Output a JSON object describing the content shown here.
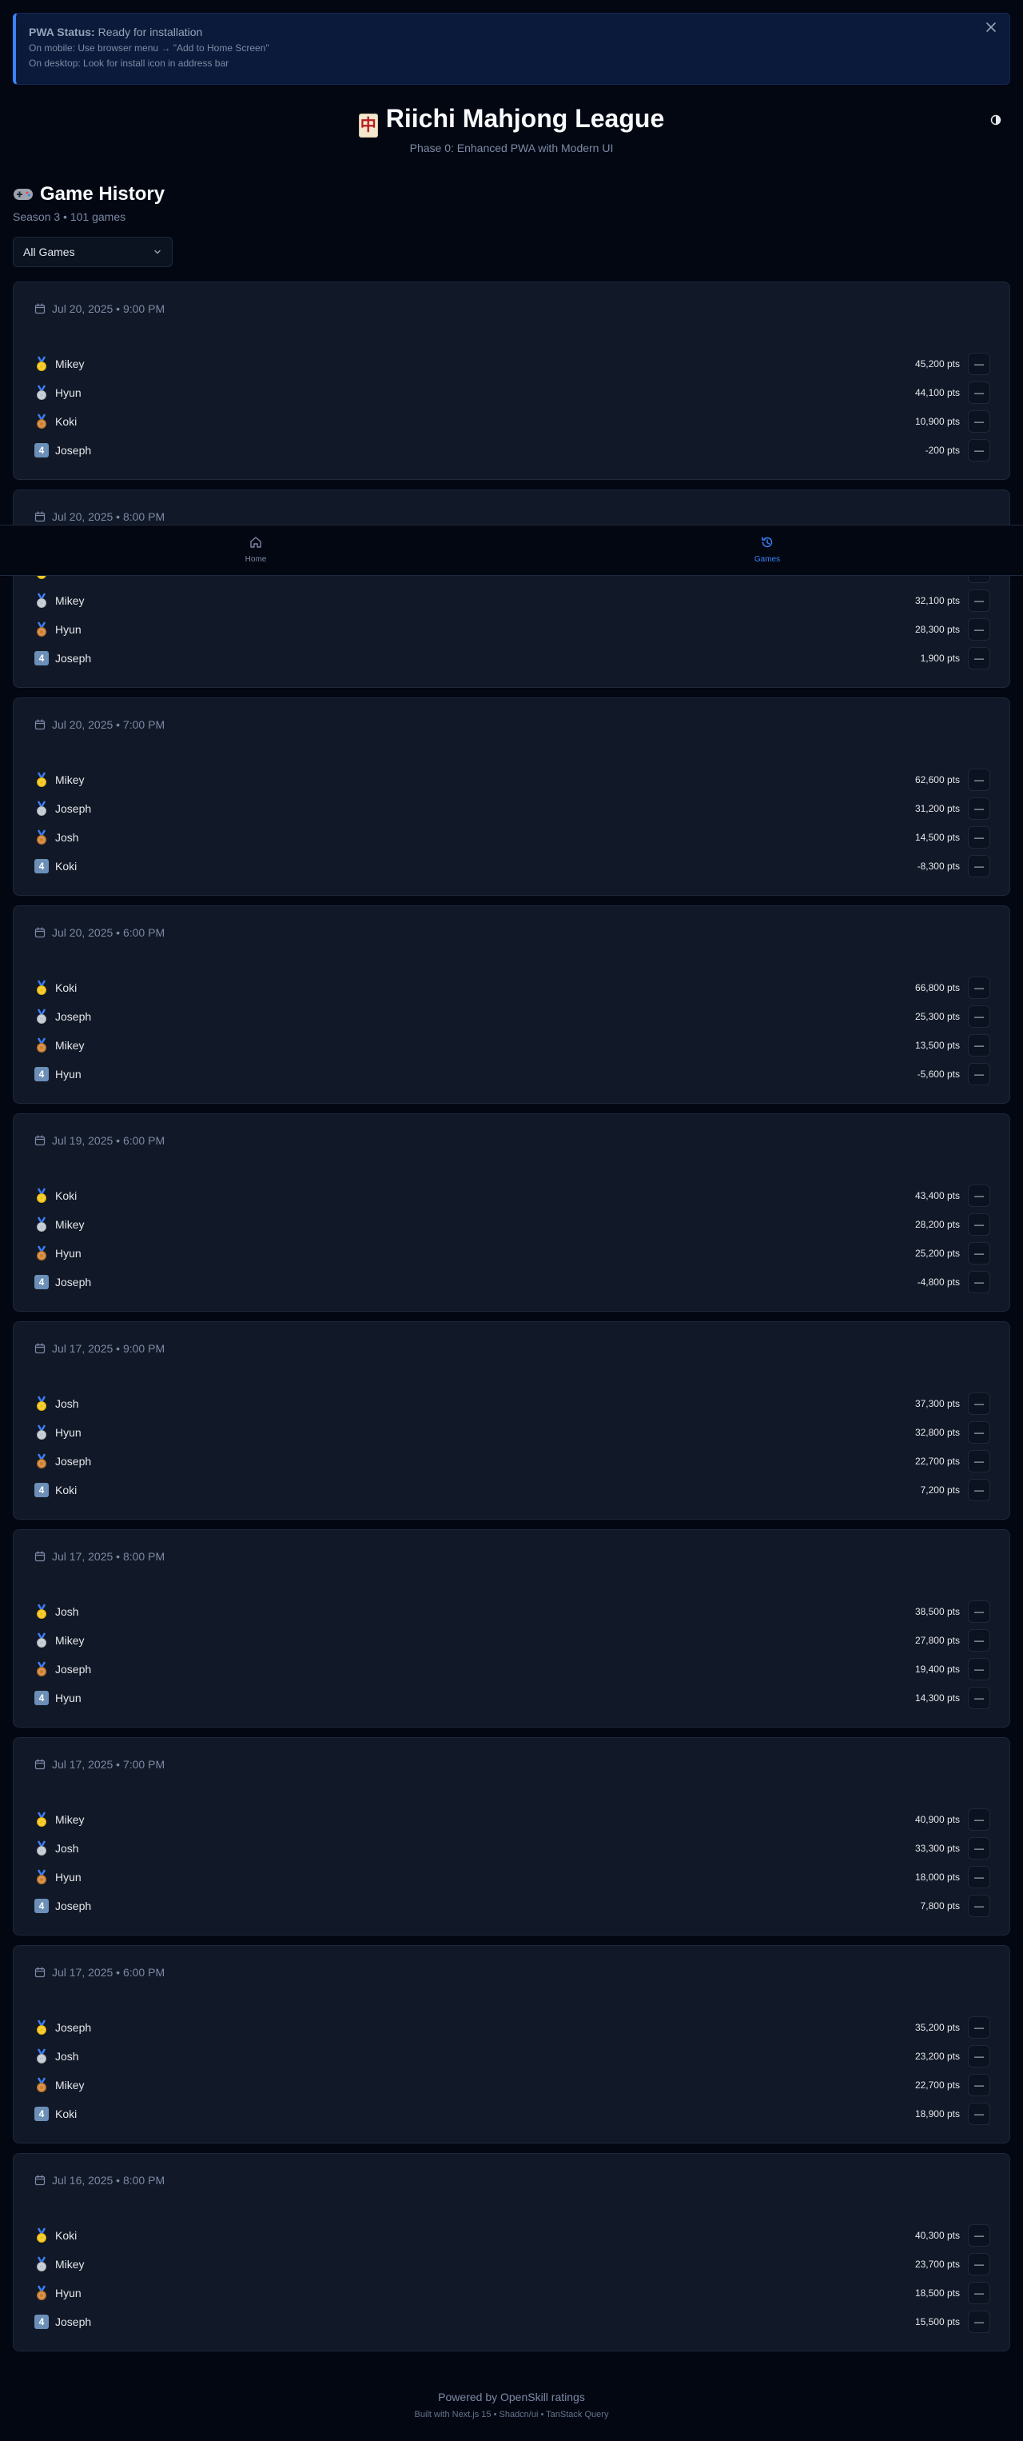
{
  "pwa": {
    "status_label": "PWA Status:",
    "status_value": "Ready for installation",
    "mobile_hint": "On mobile: Use browser menu → \"Add to Home Screen\"",
    "desktop_hint": "On desktop: Look for install icon in address bar",
    "close_icon": "close-icon"
  },
  "header": {
    "title": "Riichi Mahjong League",
    "tile_glyph": "中",
    "subtitle": "Phase 0: Enhanced PWA with Modern UI",
    "theme_icon": "sun-moon-icon"
  },
  "history": {
    "title": "Game History",
    "subtitle": "Season 3 • 101 games",
    "filter_value": "All Games"
  },
  "games": [
    {
      "date": "Jul 20, 2025 • 9:00 PM",
      "players": [
        {
          "rank": 1,
          "name": "Mikey",
          "pts": "45,200 pts"
        },
        {
          "rank": 2,
          "name": "Hyun",
          "pts": "44,100 pts"
        },
        {
          "rank": 3,
          "name": "Koki",
          "pts": "10,900 pts"
        },
        {
          "rank": 4,
          "name": "Joseph",
          "pts": "-200 pts"
        }
      ]
    },
    {
      "date": "Jul 20, 2025 • 8:00 PM",
      "players": [
        {
          "rank": 1,
          "name": "",
          "pts": ""
        },
        {
          "rank": 2,
          "name": "Mikey",
          "pts": "32,100 pts"
        },
        {
          "rank": 3,
          "name": "Hyun",
          "pts": "28,300 pts"
        },
        {
          "rank": 4,
          "name": "Joseph",
          "pts": "1,900 pts"
        }
      ]
    },
    {
      "date": "Jul 20, 2025 • 7:00 PM",
      "players": [
        {
          "rank": 1,
          "name": "Mikey",
          "pts": "62,600 pts"
        },
        {
          "rank": 2,
          "name": "Joseph",
          "pts": "31,200 pts"
        },
        {
          "rank": 3,
          "name": "Josh",
          "pts": "14,500 pts"
        },
        {
          "rank": 4,
          "name": "Koki",
          "pts": "-8,300 pts"
        }
      ]
    },
    {
      "date": "Jul 20, 2025 • 6:00 PM",
      "players": [
        {
          "rank": 1,
          "name": "Koki",
          "pts": "66,800 pts"
        },
        {
          "rank": 2,
          "name": "Joseph",
          "pts": "25,300 pts"
        },
        {
          "rank": 3,
          "name": "Mikey",
          "pts": "13,500 pts"
        },
        {
          "rank": 4,
          "name": "Hyun",
          "pts": "-5,600 pts"
        }
      ]
    },
    {
      "date": "Jul 19, 2025 • 6:00 PM",
      "players": [
        {
          "rank": 1,
          "name": "Koki",
          "pts": "43,400 pts"
        },
        {
          "rank": 2,
          "name": "Mikey",
          "pts": "28,200 pts"
        },
        {
          "rank": 3,
          "name": "Hyun",
          "pts": "25,200 pts"
        },
        {
          "rank": 4,
          "name": "Joseph",
          "pts": "-4,800 pts"
        }
      ]
    },
    {
      "date": "Jul 17, 2025 • 9:00 PM",
      "players": [
        {
          "rank": 1,
          "name": "Josh",
          "pts": "37,300 pts"
        },
        {
          "rank": 2,
          "name": "Hyun",
          "pts": "32,800 pts"
        },
        {
          "rank": 3,
          "name": "Joseph",
          "pts": "22,700 pts"
        },
        {
          "rank": 4,
          "name": "Koki",
          "pts": "7,200 pts"
        }
      ]
    },
    {
      "date": "Jul 17, 2025 • 8:00 PM",
      "players": [
        {
          "rank": 1,
          "name": "Josh",
          "pts": "38,500 pts"
        },
        {
          "rank": 2,
          "name": "Mikey",
          "pts": "27,800 pts"
        },
        {
          "rank": 3,
          "name": "Joseph",
          "pts": "19,400 pts"
        },
        {
          "rank": 4,
          "name": "Hyun",
          "pts": "14,300 pts"
        }
      ]
    },
    {
      "date": "Jul 17, 2025 • 7:00 PM",
      "players": [
        {
          "rank": 1,
          "name": "Mikey",
          "pts": "40,900 pts"
        },
        {
          "rank": 2,
          "name": "Josh",
          "pts": "33,300 pts"
        },
        {
          "rank": 3,
          "name": "Hyun",
          "pts": "18,000 pts"
        },
        {
          "rank": 4,
          "name": "Joseph",
          "pts": "7,800 pts"
        }
      ]
    },
    {
      "date": "Jul 17, 2025 • 6:00 PM",
      "players": [
        {
          "rank": 1,
          "name": "Joseph",
          "pts": "35,200 pts"
        },
        {
          "rank": 2,
          "name": "Josh",
          "pts": "23,200 pts"
        },
        {
          "rank": 3,
          "name": "Mikey",
          "pts": "22,700 pts"
        },
        {
          "rank": 4,
          "name": "Koki",
          "pts": "18,900 pts"
        }
      ]
    },
    {
      "date": "Jul 16, 2025 • 8:00 PM",
      "players": [
        {
          "rank": 1,
          "name": "Koki",
          "pts": "40,300 pts"
        },
        {
          "rank": 2,
          "name": "Mikey",
          "pts": "23,700 pts"
        },
        {
          "rank": 3,
          "name": "Hyun",
          "pts": "18,500 pts"
        },
        {
          "rank": 4,
          "name": "Joseph",
          "pts": "15,500 pts"
        }
      ]
    }
  ],
  "row_action_label": "—",
  "rank4_label": "4",
  "nav": {
    "home_label": "Home",
    "games_label": "Games",
    "home_icon": "home-icon",
    "games_icon": "history-icon",
    "active": "games"
  },
  "footer": {
    "line1": "Powered by OpenSkill ratings",
    "line2": "Built with Next.js 15 • Shadcn/ui • TanStack Query"
  },
  "colors": {
    "background": "#030712",
    "card": "#111827",
    "accent": "#3b82f6",
    "gold": "#f5c518",
    "silver": "#c0c7d0",
    "bronze": "#cd7f32"
  }
}
